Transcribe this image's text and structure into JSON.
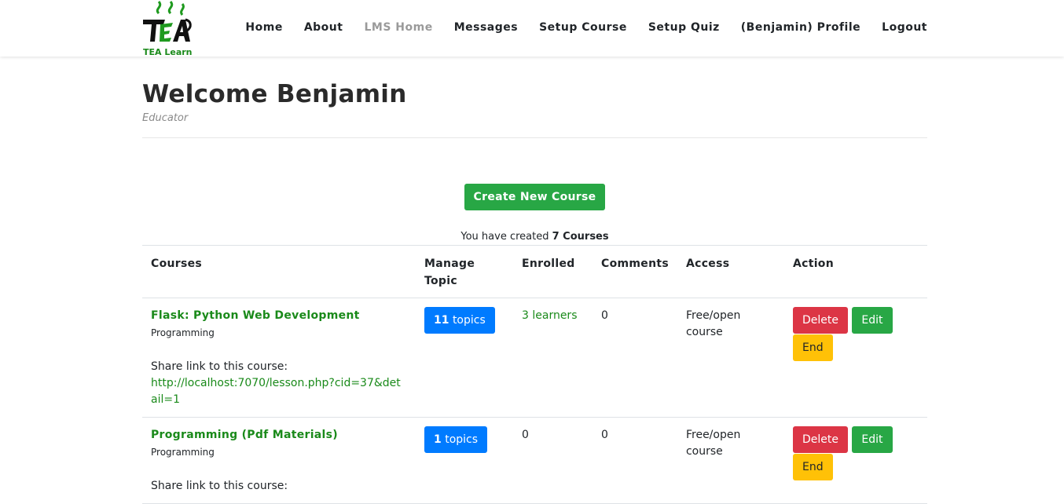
{
  "brand": {
    "name": "TEA Learn"
  },
  "nav": [
    {
      "label": "Home",
      "muted": false
    },
    {
      "label": "About",
      "muted": false
    },
    {
      "label": "LMS Home",
      "muted": true
    },
    {
      "label": "Messages",
      "muted": false
    },
    {
      "label": "Setup Course",
      "muted": false
    },
    {
      "label": "Setup Quiz",
      "muted": false
    },
    {
      "label": "(Benjamin) Profile",
      "muted": false
    },
    {
      "label": "Logout",
      "muted": false
    }
  ],
  "header": {
    "title": "Welcome Benjamin",
    "role": "Educator"
  },
  "create_button": "Create New Course",
  "summary": {
    "prefix": "You have created",
    "count": "7 Courses"
  },
  "table": {
    "headers": [
      "Courses",
      "Manage Topic",
      "Enrolled",
      "Comments",
      "Access",
      "Action"
    ],
    "share_label": "Share link to this course:",
    "actions": {
      "delete": "Delete",
      "edit": "Edit",
      "end": "End"
    },
    "rows": [
      {
        "title": "Flask: Python Web Development",
        "category": "Programming",
        "share_link": "http://localhost:7070/lesson.php?cid=37&detail=1",
        "topics_count": "11",
        "topics_word": "topics",
        "enrolled": "3 learners",
        "enrolled_is_link": true,
        "comments": "0",
        "access": "Free/open course"
      },
      {
        "title": "Programming (Pdf Materials)",
        "category": "Programming",
        "share_link": "",
        "topics_count": "1",
        "topics_word": "topics",
        "enrolled": "0",
        "enrolled_is_link": false,
        "comments": "0",
        "access": "Free/open course"
      }
    ]
  },
  "colors": {
    "brand_green": "#1a8a1a",
    "success": "#28a745",
    "primary": "#007bff",
    "danger": "#dc3545",
    "warning": "#ffc107"
  }
}
